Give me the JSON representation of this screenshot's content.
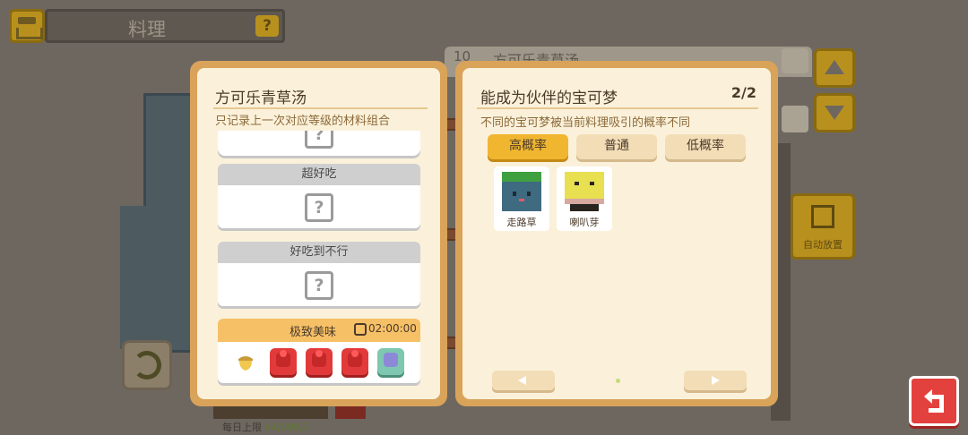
{
  "header": {
    "title": "料理",
    "help_symbol": "?"
  },
  "background": {
    "recipe_number": "10",
    "recipe_name": "方可乐青草汤",
    "auto_place_label": "自动放置",
    "limit_prefix": "每日上限",
    "limit_value": "44/999只"
  },
  "left_page": {
    "title": "方可乐青草汤",
    "subtitle": "只记录上一次对应等级的材料组合",
    "qmark": "?",
    "slots": [
      {
        "label": "超好吃"
      },
      {
        "label": "好吃到不行"
      }
    ],
    "best": {
      "label": "极致美味",
      "timer": "02:00:00",
      "ingredients": [
        "acorn-icon",
        "red-ingredient-icon",
        "red-ingredient-icon",
        "red-ingredient-icon",
        "blue-ingredient-icon"
      ]
    }
  },
  "right_page": {
    "title": "能成为伙伴的宝可梦",
    "page_indicator": "2/2",
    "subtitle": "不同的宝可梦被当前料理吸引的概率不同",
    "tabs": [
      {
        "label": "高概率",
        "active": true
      },
      {
        "label": "普通",
        "active": false
      },
      {
        "label": "低概率",
        "active": false
      }
    ],
    "pokemon": [
      {
        "name": "走路草",
        "color": "#3f6b80",
        "top_color": "#3fa040"
      },
      {
        "name": "喇叭芽",
        "color": "#e8e050",
        "top_color": "#e8e050"
      }
    ]
  },
  "colors": {
    "book_border": "#d9a35a",
    "page": "#fbf1da",
    "active_tab": "#f0b630",
    "exit_button": "#e3413e"
  }
}
